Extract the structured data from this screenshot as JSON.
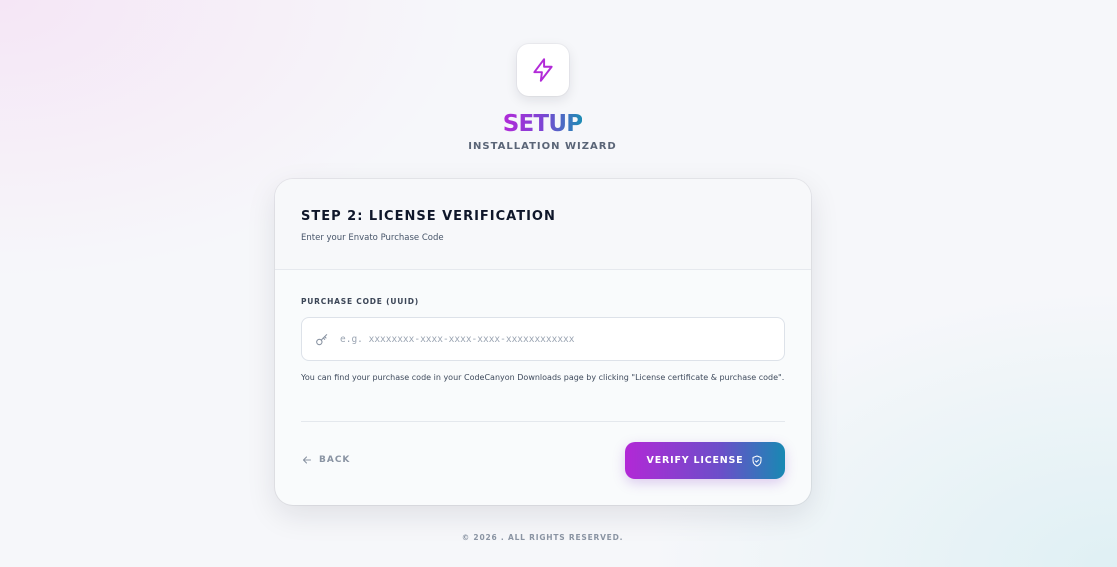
{
  "brand": {
    "logo_icon": "lightning-bolt-icon",
    "name": "SETUP",
    "subtitle": "INSTALLATION WIZARD",
    "gradient": [
      "#b22ad8",
      "#1c8db4"
    ]
  },
  "card": {
    "title": "STEP 2: LICENSE VERIFICATION",
    "subtitle": "Enter your Envato Purchase Code",
    "field": {
      "label": "PURCHASE CODE (UUID)",
      "icon": "key-icon",
      "value": "",
      "placeholder": "e.g. xxxxxxxx-xxxx-xxxx-xxxx-xxxxxxxxxxxx"
    },
    "help_text": "You can find your purchase code in your CodeCanyon Downloads page by clicking \"License certificate & purchase code\".",
    "back_label": "BACK",
    "back_icon": "arrow-left-icon",
    "verify_label": "VERIFY LICENSE",
    "verify_icon": "shield-check-icon"
  },
  "footer": {
    "text": "© 2026 . ALL RIGHTS RESERVED."
  }
}
